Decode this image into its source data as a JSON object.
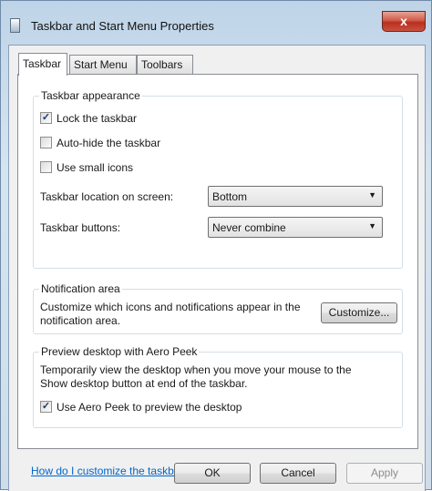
{
  "window": {
    "title": "Taskbar and Start Menu Properties",
    "close_label": "x"
  },
  "tabs": [
    {
      "label": "Taskbar",
      "active": true
    },
    {
      "label": "Start Menu",
      "active": false
    },
    {
      "label": "Toolbars",
      "active": false
    }
  ],
  "appearance": {
    "title": "Taskbar appearance",
    "options": [
      {
        "label": "Lock the taskbar",
        "checked": true
      },
      {
        "label": "Auto-hide the taskbar",
        "checked": false
      },
      {
        "label": "Use small icons",
        "checked": false
      }
    ],
    "location": {
      "label": "Taskbar location on screen:",
      "value": "Bottom"
    },
    "buttons": {
      "label": "Taskbar buttons:",
      "value": "Never combine"
    }
  },
  "notification": {
    "title": "Notification area",
    "text_line1": "Customize which icons and notifications appear in the",
    "text_line2": "notification area.",
    "customize_label": "Customize..."
  },
  "peek": {
    "title": "Preview desktop with Aero Peek",
    "text_line1": "Temporarily view the desktop when you move your mouse to the",
    "text_line2": "Show desktop button at end of the taskbar.",
    "option": {
      "label": "Use Aero Peek to preview the desktop",
      "checked": true
    }
  },
  "help_link": "How do I customize the taskbar?",
  "footer": {
    "ok_label": "OK",
    "cancel_label": "Cancel",
    "apply_label": "Apply"
  },
  "icons": {
    "check": "✓",
    "dropdown": "▼"
  }
}
